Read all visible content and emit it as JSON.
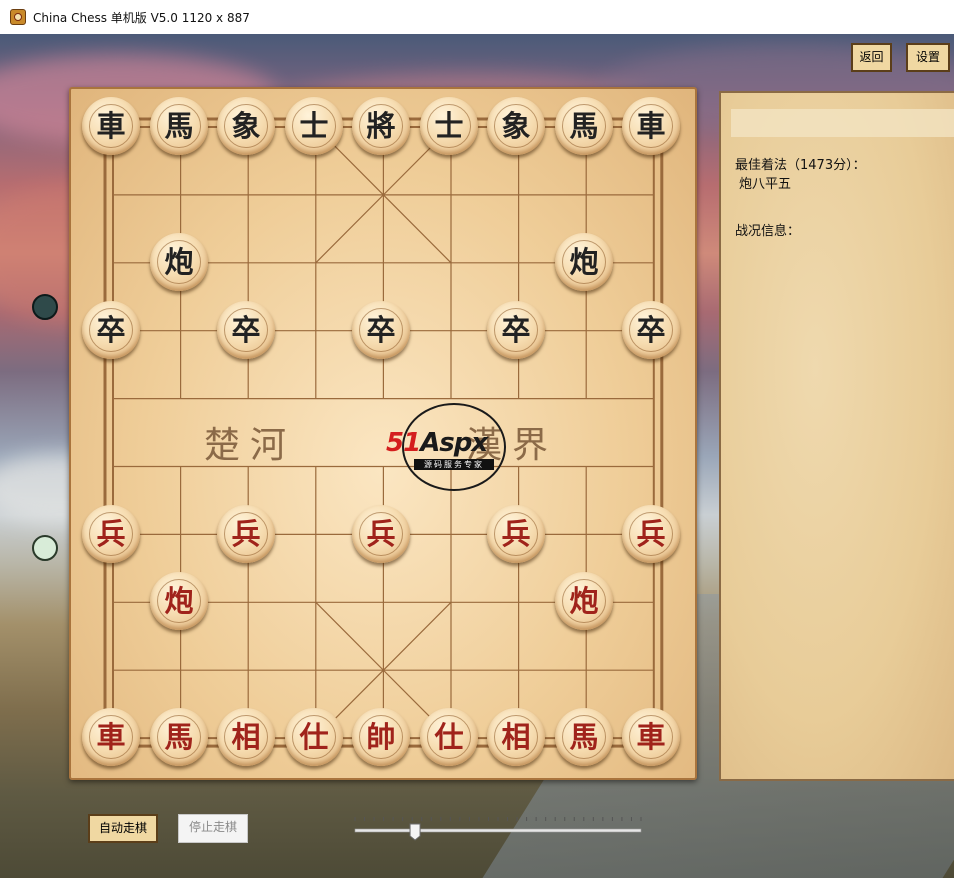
{
  "window": {
    "title": "China Chess 单机版 V5.0  1120 x 887"
  },
  "top_buttons": {
    "back": "返回",
    "settings": "设置"
  },
  "river": {
    "left": "楚河",
    "right": "漢界"
  },
  "watermark": {
    "brand_num": "51",
    "brand_text": "Aspx",
    "tagline": "源码服务专家"
  },
  "pieces": {
    "black": {
      "back_rank": [
        "車",
        "馬",
        "象",
        "士",
        "將",
        "士",
        "象",
        "馬",
        "車"
      ],
      "cannon": "炮",
      "soldier": "卒"
    },
    "red": {
      "back_rank": [
        "車",
        "馬",
        "相",
        "仕",
        "帥",
        "仕",
        "相",
        "馬",
        "車"
      ],
      "cannon": "炮",
      "soldier": "兵"
    }
  },
  "panel": {
    "best_move_label": "最佳着法（1473分）：",
    "best_move": "炮八平五",
    "battle_info_label": "战况信息："
  },
  "bottom": {
    "auto_play": "自动走棋",
    "stop_play": "停止走棋",
    "speed_level": 0.21
  },
  "colors": {
    "red_piece": "#a0231b",
    "black_piece": "#222222",
    "board_line": "#9a6a3c",
    "button_bg": "#f0d8a2"
  }
}
